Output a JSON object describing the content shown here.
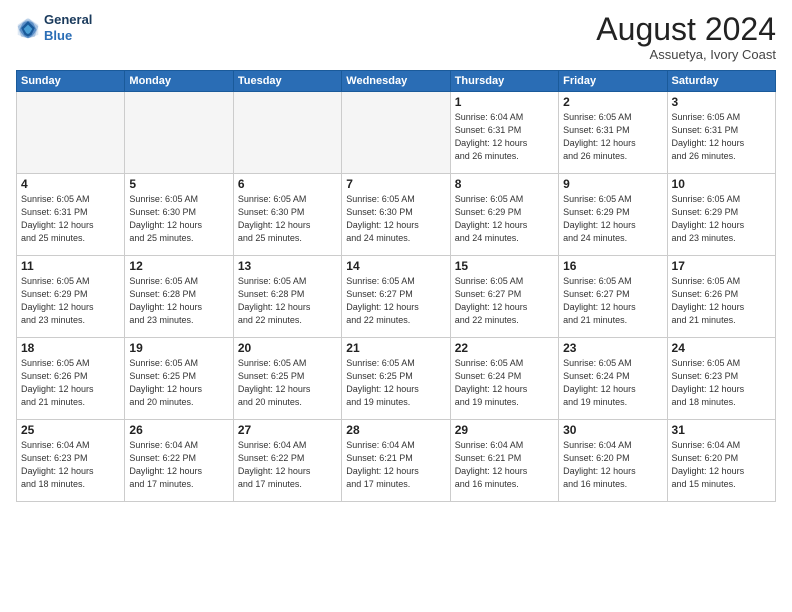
{
  "header": {
    "logo_line1": "General",
    "logo_line2": "Blue",
    "month_title": "August 2024",
    "subtitle": "Assuetya, Ivory Coast"
  },
  "days_of_week": [
    "Sunday",
    "Monday",
    "Tuesday",
    "Wednesday",
    "Thursday",
    "Friday",
    "Saturday"
  ],
  "weeks": [
    [
      {
        "day": "",
        "info": ""
      },
      {
        "day": "",
        "info": ""
      },
      {
        "day": "",
        "info": ""
      },
      {
        "day": "",
        "info": ""
      },
      {
        "day": "1",
        "info": "Sunrise: 6:04 AM\nSunset: 6:31 PM\nDaylight: 12 hours\nand 26 minutes."
      },
      {
        "day": "2",
        "info": "Sunrise: 6:05 AM\nSunset: 6:31 PM\nDaylight: 12 hours\nand 26 minutes."
      },
      {
        "day": "3",
        "info": "Sunrise: 6:05 AM\nSunset: 6:31 PM\nDaylight: 12 hours\nand 26 minutes."
      }
    ],
    [
      {
        "day": "4",
        "info": "Sunrise: 6:05 AM\nSunset: 6:31 PM\nDaylight: 12 hours\nand 25 minutes."
      },
      {
        "day": "5",
        "info": "Sunrise: 6:05 AM\nSunset: 6:30 PM\nDaylight: 12 hours\nand 25 minutes."
      },
      {
        "day": "6",
        "info": "Sunrise: 6:05 AM\nSunset: 6:30 PM\nDaylight: 12 hours\nand 25 minutes."
      },
      {
        "day": "7",
        "info": "Sunrise: 6:05 AM\nSunset: 6:30 PM\nDaylight: 12 hours\nand 24 minutes."
      },
      {
        "day": "8",
        "info": "Sunrise: 6:05 AM\nSunset: 6:29 PM\nDaylight: 12 hours\nand 24 minutes."
      },
      {
        "day": "9",
        "info": "Sunrise: 6:05 AM\nSunset: 6:29 PM\nDaylight: 12 hours\nand 24 minutes."
      },
      {
        "day": "10",
        "info": "Sunrise: 6:05 AM\nSunset: 6:29 PM\nDaylight: 12 hours\nand 23 minutes."
      }
    ],
    [
      {
        "day": "11",
        "info": "Sunrise: 6:05 AM\nSunset: 6:29 PM\nDaylight: 12 hours\nand 23 minutes."
      },
      {
        "day": "12",
        "info": "Sunrise: 6:05 AM\nSunset: 6:28 PM\nDaylight: 12 hours\nand 23 minutes."
      },
      {
        "day": "13",
        "info": "Sunrise: 6:05 AM\nSunset: 6:28 PM\nDaylight: 12 hours\nand 22 minutes."
      },
      {
        "day": "14",
        "info": "Sunrise: 6:05 AM\nSunset: 6:27 PM\nDaylight: 12 hours\nand 22 minutes."
      },
      {
        "day": "15",
        "info": "Sunrise: 6:05 AM\nSunset: 6:27 PM\nDaylight: 12 hours\nand 22 minutes."
      },
      {
        "day": "16",
        "info": "Sunrise: 6:05 AM\nSunset: 6:27 PM\nDaylight: 12 hours\nand 21 minutes."
      },
      {
        "day": "17",
        "info": "Sunrise: 6:05 AM\nSunset: 6:26 PM\nDaylight: 12 hours\nand 21 minutes."
      }
    ],
    [
      {
        "day": "18",
        "info": "Sunrise: 6:05 AM\nSunset: 6:26 PM\nDaylight: 12 hours\nand 21 minutes."
      },
      {
        "day": "19",
        "info": "Sunrise: 6:05 AM\nSunset: 6:25 PM\nDaylight: 12 hours\nand 20 minutes."
      },
      {
        "day": "20",
        "info": "Sunrise: 6:05 AM\nSunset: 6:25 PM\nDaylight: 12 hours\nand 20 minutes."
      },
      {
        "day": "21",
        "info": "Sunrise: 6:05 AM\nSunset: 6:25 PM\nDaylight: 12 hours\nand 19 minutes."
      },
      {
        "day": "22",
        "info": "Sunrise: 6:05 AM\nSunset: 6:24 PM\nDaylight: 12 hours\nand 19 minutes."
      },
      {
        "day": "23",
        "info": "Sunrise: 6:05 AM\nSunset: 6:24 PM\nDaylight: 12 hours\nand 19 minutes."
      },
      {
        "day": "24",
        "info": "Sunrise: 6:05 AM\nSunset: 6:23 PM\nDaylight: 12 hours\nand 18 minutes."
      }
    ],
    [
      {
        "day": "25",
        "info": "Sunrise: 6:04 AM\nSunset: 6:23 PM\nDaylight: 12 hours\nand 18 minutes."
      },
      {
        "day": "26",
        "info": "Sunrise: 6:04 AM\nSunset: 6:22 PM\nDaylight: 12 hours\nand 17 minutes."
      },
      {
        "day": "27",
        "info": "Sunrise: 6:04 AM\nSunset: 6:22 PM\nDaylight: 12 hours\nand 17 minutes."
      },
      {
        "day": "28",
        "info": "Sunrise: 6:04 AM\nSunset: 6:21 PM\nDaylight: 12 hours\nand 17 minutes."
      },
      {
        "day": "29",
        "info": "Sunrise: 6:04 AM\nSunset: 6:21 PM\nDaylight: 12 hours\nand 16 minutes."
      },
      {
        "day": "30",
        "info": "Sunrise: 6:04 AM\nSunset: 6:20 PM\nDaylight: 12 hours\nand 16 minutes."
      },
      {
        "day": "31",
        "info": "Sunrise: 6:04 AM\nSunset: 6:20 PM\nDaylight: 12 hours\nand 15 minutes."
      }
    ]
  ]
}
